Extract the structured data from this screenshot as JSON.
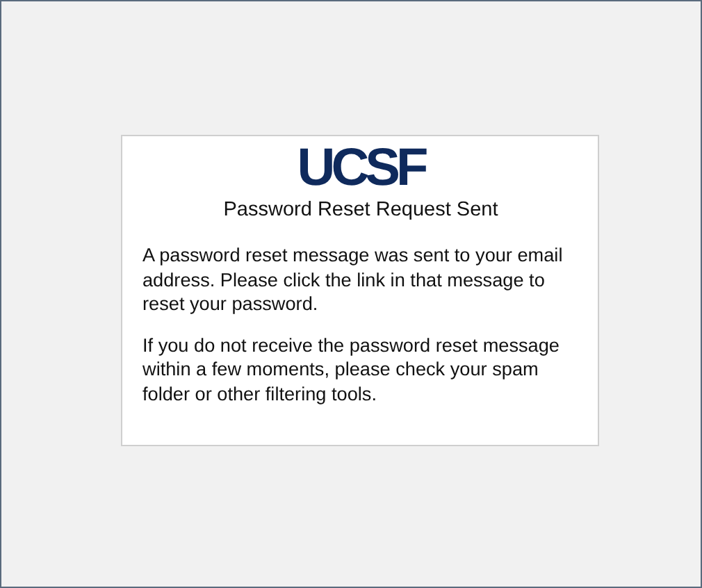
{
  "logo": "UCSF",
  "title": "Password Reset Request Sent",
  "paragraphs": [
    "A password reset message was sent to your email address. Please click the link in that message to reset your password.",
    "If you do not receive the password reset message within a few moments, please check your spam folder or other filtering tools."
  ]
}
